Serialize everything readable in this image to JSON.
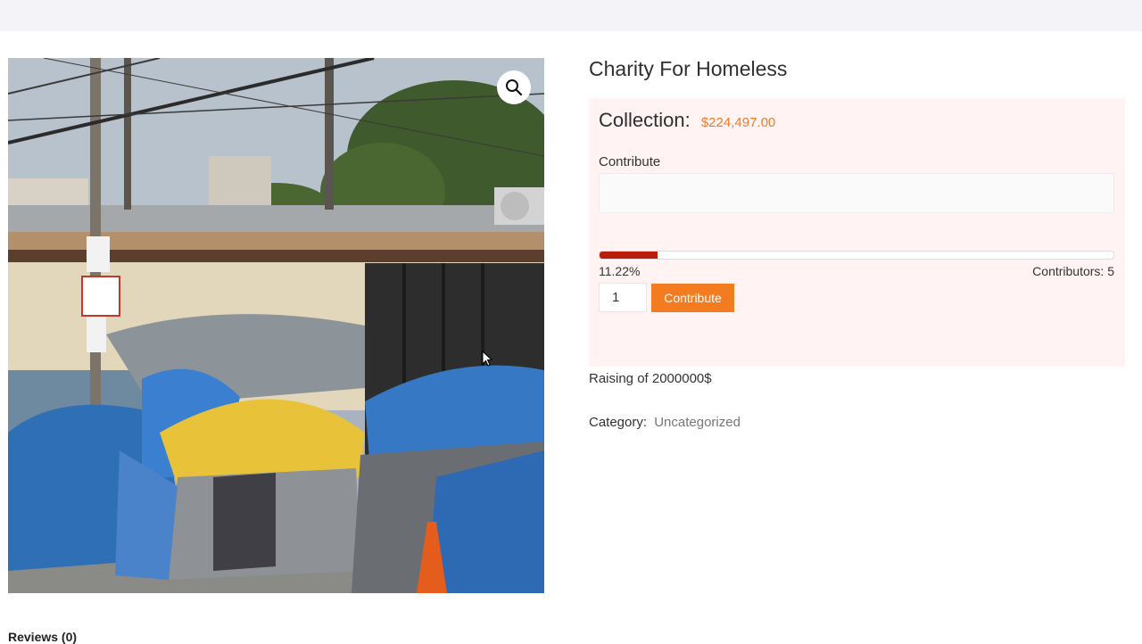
{
  "product": {
    "title": "Charity For Homeless",
    "image_alt": "Tents on a sidewalk"
  },
  "campaign": {
    "collection_label": "Collection:",
    "collection_amount": "$224,497.00",
    "contribute_label": "Contribute",
    "contribute_input_value": "",
    "progress_percent": 11.22,
    "progress_text": "11.22%",
    "contributors_text": "Contributors: 5",
    "quantity_value": "1",
    "contribute_button_label": "Contribute"
  },
  "meta": {
    "raising_text": "Raising of 2000000$",
    "category_label": "Category:",
    "category_value": "Uncategorized"
  },
  "tabs": {
    "reviews_label": "Reviews (0)"
  },
  "icons": {
    "zoom": "magnifier-icon",
    "cursor": "mouse-pointer-icon"
  },
  "colors": {
    "accent": "#f47c20",
    "progress": "#b81c0c",
    "panel": "#fff3f3"
  }
}
